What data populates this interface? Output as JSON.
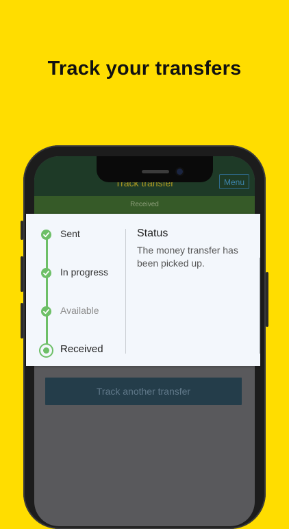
{
  "promo": {
    "headline": "Track your transfers"
  },
  "app": {
    "title": "Track transfer",
    "menu_label": "Menu",
    "banner_status": "Received",
    "track_another_label": "Track another transfer"
  },
  "tracker": {
    "steps": [
      {
        "label": "Sent",
        "state": "done"
      },
      {
        "label": "In progress",
        "state": "done"
      },
      {
        "label": "Available",
        "state": "done-muted"
      },
      {
        "label": "Received",
        "state": "current"
      }
    ],
    "status_title": "Status",
    "status_description": "The money transfer has been picked up."
  },
  "colors": {
    "background": "#FFDD00",
    "accent_green": "#6dbf67",
    "header_green": "#1e3a27",
    "button_blue": "#243d4a"
  },
  "icons": {
    "step_done": "check-icon",
    "step_current": "radio-dot-icon"
  }
}
